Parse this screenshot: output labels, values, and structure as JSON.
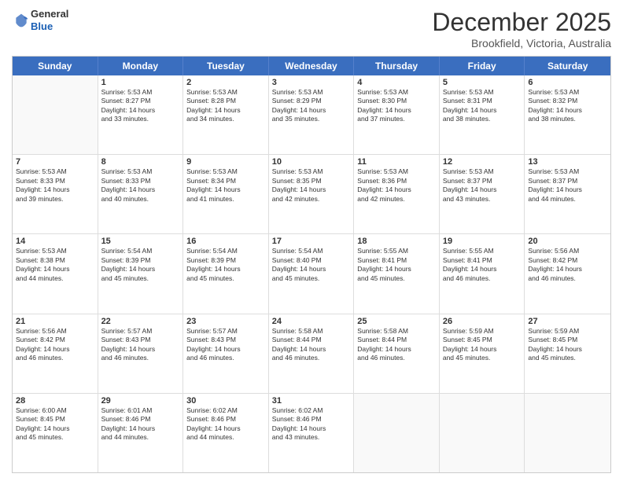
{
  "logo": {
    "general": "General",
    "blue": "Blue"
  },
  "header": {
    "month": "December 2025",
    "location": "Brookfield, Victoria, Australia"
  },
  "weekdays": [
    "Sunday",
    "Monday",
    "Tuesday",
    "Wednesday",
    "Thursday",
    "Friday",
    "Saturday"
  ],
  "rows": [
    [
      {
        "day": "",
        "info": ""
      },
      {
        "day": "1",
        "info": "Sunrise: 5:53 AM\nSunset: 8:27 PM\nDaylight: 14 hours\nand 33 minutes."
      },
      {
        "day": "2",
        "info": "Sunrise: 5:53 AM\nSunset: 8:28 PM\nDaylight: 14 hours\nand 34 minutes."
      },
      {
        "day": "3",
        "info": "Sunrise: 5:53 AM\nSunset: 8:29 PM\nDaylight: 14 hours\nand 35 minutes."
      },
      {
        "day": "4",
        "info": "Sunrise: 5:53 AM\nSunset: 8:30 PM\nDaylight: 14 hours\nand 37 minutes."
      },
      {
        "day": "5",
        "info": "Sunrise: 5:53 AM\nSunset: 8:31 PM\nDaylight: 14 hours\nand 38 minutes."
      },
      {
        "day": "6",
        "info": "Sunrise: 5:53 AM\nSunset: 8:32 PM\nDaylight: 14 hours\nand 38 minutes."
      }
    ],
    [
      {
        "day": "7",
        "info": "Sunrise: 5:53 AM\nSunset: 8:33 PM\nDaylight: 14 hours\nand 39 minutes."
      },
      {
        "day": "8",
        "info": "Sunrise: 5:53 AM\nSunset: 8:33 PM\nDaylight: 14 hours\nand 40 minutes."
      },
      {
        "day": "9",
        "info": "Sunrise: 5:53 AM\nSunset: 8:34 PM\nDaylight: 14 hours\nand 41 minutes."
      },
      {
        "day": "10",
        "info": "Sunrise: 5:53 AM\nSunset: 8:35 PM\nDaylight: 14 hours\nand 42 minutes."
      },
      {
        "day": "11",
        "info": "Sunrise: 5:53 AM\nSunset: 8:36 PM\nDaylight: 14 hours\nand 42 minutes."
      },
      {
        "day": "12",
        "info": "Sunrise: 5:53 AM\nSunset: 8:37 PM\nDaylight: 14 hours\nand 43 minutes."
      },
      {
        "day": "13",
        "info": "Sunrise: 5:53 AM\nSunset: 8:37 PM\nDaylight: 14 hours\nand 44 minutes."
      }
    ],
    [
      {
        "day": "14",
        "info": "Sunrise: 5:53 AM\nSunset: 8:38 PM\nDaylight: 14 hours\nand 44 minutes."
      },
      {
        "day": "15",
        "info": "Sunrise: 5:54 AM\nSunset: 8:39 PM\nDaylight: 14 hours\nand 45 minutes."
      },
      {
        "day": "16",
        "info": "Sunrise: 5:54 AM\nSunset: 8:39 PM\nDaylight: 14 hours\nand 45 minutes."
      },
      {
        "day": "17",
        "info": "Sunrise: 5:54 AM\nSunset: 8:40 PM\nDaylight: 14 hours\nand 45 minutes."
      },
      {
        "day": "18",
        "info": "Sunrise: 5:55 AM\nSunset: 8:41 PM\nDaylight: 14 hours\nand 45 minutes."
      },
      {
        "day": "19",
        "info": "Sunrise: 5:55 AM\nSunset: 8:41 PM\nDaylight: 14 hours\nand 46 minutes."
      },
      {
        "day": "20",
        "info": "Sunrise: 5:56 AM\nSunset: 8:42 PM\nDaylight: 14 hours\nand 46 minutes."
      }
    ],
    [
      {
        "day": "21",
        "info": "Sunrise: 5:56 AM\nSunset: 8:42 PM\nDaylight: 14 hours\nand 46 minutes."
      },
      {
        "day": "22",
        "info": "Sunrise: 5:57 AM\nSunset: 8:43 PM\nDaylight: 14 hours\nand 46 minutes."
      },
      {
        "day": "23",
        "info": "Sunrise: 5:57 AM\nSunset: 8:43 PM\nDaylight: 14 hours\nand 46 minutes."
      },
      {
        "day": "24",
        "info": "Sunrise: 5:58 AM\nSunset: 8:44 PM\nDaylight: 14 hours\nand 46 minutes."
      },
      {
        "day": "25",
        "info": "Sunrise: 5:58 AM\nSunset: 8:44 PM\nDaylight: 14 hours\nand 46 minutes."
      },
      {
        "day": "26",
        "info": "Sunrise: 5:59 AM\nSunset: 8:45 PM\nDaylight: 14 hours\nand 45 minutes."
      },
      {
        "day": "27",
        "info": "Sunrise: 5:59 AM\nSunset: 8:45 PM\nDaylight: 14 hours\nand 45 minutes."
      }
    ],
    [
      {
        "day": "28",
        "info": "Sunrise: 6:00 AM\nSunset: 8:45 PM\nDaylight: 14 hours\nand 45 minutes."
      },
      {
        "day": "29",
        "info": "Sunrise: 6:01 AM\nSunset: 8:46 PM\nDaylight: 14 hours\nand 44 minutes."
      },
      {
        "day": "30",
        "info": "Sunrise: 6:02 AM\nSunset: 8:46 PM\nDaylight: 14 hours\nand 44 minutes."
      },
      {
        "day": "31",
        "info": "Sunrise: 6:02 AM\nSunset: 8:46 PM\nDaylight: 14 hours\nand 43 minutes."
      },
      {
        "day": "",
        "info": ""
      },
      {
        "day": "",
        "info": ""
      },
      {
        "day": "",
        "info": ""
      }
    ]
  ]
}
